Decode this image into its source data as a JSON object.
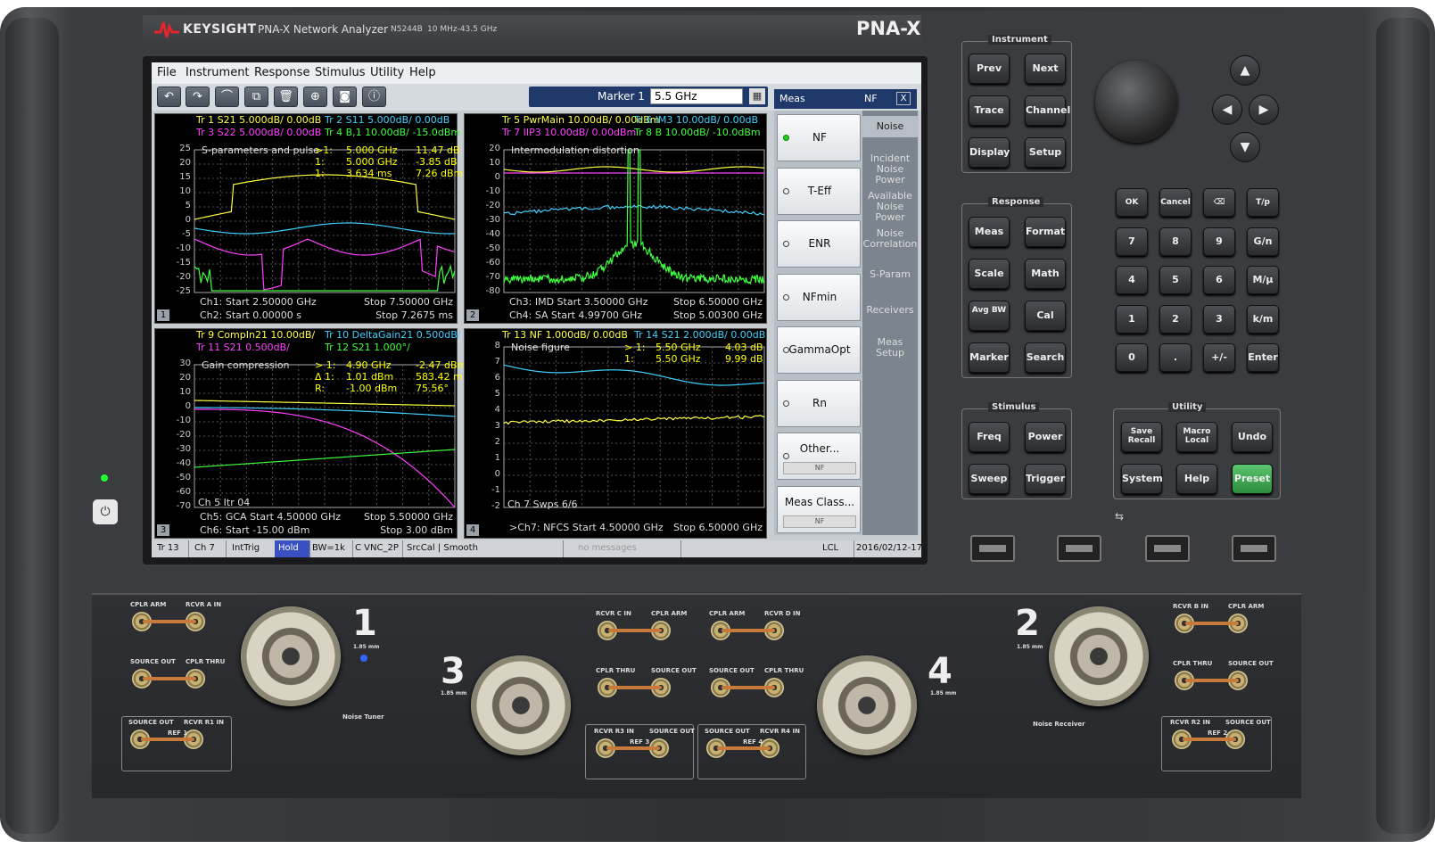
{
  "header": {
    "brand": "KEYSIGHT",
    "model_name": "PNA-X Network Analyzer",
    "model_number": "N5244B",
    "freq_range": "10 MHz-43.5 GHz",
    "series": "PNA-X"
  },
  "menu": [
    "File",
    "Instrument",
    "Response",
    "Stimulus",
    "Utility",
    "Help"
  ],
  "toolbar": {
    "icons": [
      "undo-icon",
      "redo-icon",
      "marker-add-icon",
      "copy-icon",
      "trash-icon",
      "zoom-icon",
      "camera-icon",
      "info-icon"
    ],
    "marker_label": "Marker 1",
    "marker_value": "5.5 GHz"
  },
  "meas_header": {
    "label": "Meas",
    "value": "NF",
    "close": "X"
  },
  "panes": [
    {
      "num": "1",
      "header": [
        {
          "text": "Tr 1  S21 5.000dB/  0.00dB",
          "color": "#ffff40"
        },
        {
          "text": "Tr 2  S11 5.000dB/  0.00dB",
          "color": "#40d0ff"
        },
        {
          "text": "Tr 3  S22 5.000dB/  0.00dB",
          "color": "#ff40ff"
        },
        {
          "text": "Tr 4  B,1 10.00dB/  -15.0dBm",
          "color": "#40ff40"
        }
      ],
      "title": "S-parameters and pulse",
      "markers": [
        {
          "idx": ">1:",
          "x": "5.000  GHz",
          "y": "11.47 dB"
        },
        {
          "idx": "1:",
          "x": "5.000  GHz",
          "y": "-3.85 dB"
        },
        {
          "idx": "1:",
          "x": "3.634  ms",
          "y": "7.26 dBm"
        }
      ],
      "yticks": [
        "25",
        "20",
        "15",
        "10",
        "5",
        "0",
        "-5",
        "-10",
        "-15",
        "-20",
        "-25"
      ],
      "footer": [
        {
          "l": "Ch1:  Start  2.50000 GHz",
          "r": "Stop  7.50000 GHz"
        },
        {
          "l": "Ch2:  Start  0.00000 s",
          "r": "Stop  7.2675 ms"
        }
      ]
    },
    {
      "num": "2",
      "header": [
        {
          "text": "Tr 5  PwrMain 10.00dB/  0.00dBm",
          "color": "#ffff40"
        },
        {
          "text": "Tr 6  IM3 10.00dB/  0.00dB",
          "color": "#40d0ff"
        },
        {
          "text": "Tr 7  IIP3 10.00dB/  0.00dBm",
          "color": "#ff40ff"
        },
        {
          "text": "Tr 8  B 10.00dB/  -10.0dBm",
          "color": "#40ff40"
        }
      ],
      "title": "Intermodulation distortion",
      "markers": [],
      "yticks": [
        "20",
        "10",
        "0",
        "-10",
        "-20",
        "-30",
        "-40",
        "-50",
        "-60",
        "-70",
        "-80"
      ],
      "footer": [
        {
          "l": "Ch3: IMD  Start  3.50000 GHz",
          "r": "Stop  6.50000 GHz"
        },
        {
          "l": "Ch4: SA  Start  4.99700 GHz",
          "r": "Stop  5.00300 GHz"
        }
      ]
    },
    {
      "num": "3",
      "header": [
        {
          "text": "Tr 9  CompIn21 10.00dB/",
          "color": "#ffff40"
        },
        {
          "text": "Tr 10  DeltaGain21 0.500dB/",
          "color": "#40d0ff"
        },
        {
          "text": "Tr 11  S21 0.500dB/",
          "color": "#ff40ff"
        },
        {
          "text": "Tr 12  S21 1.000°/",
          "color": "#40ff40"
        }
      ],
      "title": "Gain compression",
      "markers": [
        {
          "idx": "> 1:",
          "x": "4.90  GHz",
          "y": "-2.47 dBm"
        },
        {
          "idx": "Δ 1:",
          "x": "1.01  dBm",
          "y": "583.42 m°"
        },
        {
          "idx": "R:",
          "x": "-1.00  dBm",
          "y": "75.56°"
        }
      ],
      "yticks": [
        "30",
        "20",
        "10",
        "0",
        "-10",
        "-20",
        "-30",
        "-40",
        "-50",
        "-60",
        "-70"
      ],
      "extra": "Ch 5  Itr 04",
      "footer": [
        {
          "l": "Ch5: GCA  Start  4.50000 GHz",
          "r": "Stop  5.50000 GHz"
        },
        {
          "l": "Ch6:  Start  -15.00  dBm",
          "r": "Stop  3.00  dBm"
        }
      ]
    },
    {
      "num": "4",
      "header": [
        {
          "text": "Tr 13  NF 1.000dB/  0.00dB",
          "color": "#ffff40"
        },
        {
          "text": "Tr 14  S21 2.000dB/  0.00dB",
          "color": "#40d0ff"
        }
      ],
      "title": "Noise figure",
      "markers": [
        {
          "idx": "> 1:",
          "x": "5.50  GHz",
          "y": "4.03 dB"
        },
        {
          "idx": "1:",
          "x": "5.50  GHz",
          "y": "9.99 dB"
        }
      ],
      "yticks": [
        "8",
        "7",
        "6",
        "5",
        "4",
        "3",
        "2",
        "1",
        "0",
        "-1",
        "-2"
      ],
      "extra": "Ch 7  Swps  6/6",
      "footer": [
        {
          "l": ">Ch7: NFCS  Start  4.50000 GHz",
          "r": "Stop  6.50000 GHz"
        }
      ]
    }
  ],
  "softkeys": [
    {
      "label": "NF",
      "selected": true,
      "sub": ""
    },
    {
      "label": "T-Eff",
      "selected": false,
      "sub": ""
    },
    {
      "label": "ENR",
      "selected": false,
      "sub": ""
    },
    {
      "label": "NFmin",
      "selected": false,
      "sub": ""
    },
    {
      "label": "GammaOpt",
      "selected": false,
      "sub": ""
    },
    {
      "label": "Rn",
      "selected": false,
      "sub": ""
    },
    {
      "label": "Other...",
      "selected": false,
      "sub": "NF"
    },
    {
      "label": "Meas Class...",
      "selected": false,
      "sub": "NF"
    }
  ],
  "tabs": [
    "Noise",
    "Incident Noise Power",
    "Available Noise Power",
    "Noise Correlation",
    "S-Param",
    "Receivers",
    "Meas Setup"
  ],
  "status": [
    "Tr 13",
    "Ch 7",
    "IntTrig",
    "Hold",
    "BW=1k",
    "C  VNC_2P",
    "SrcCal | Smooth",
    "no messages",
    "LCL",
    "2016/02/12-17:58"
  ],
  "front_panel": {
    "instrument": {
      "label": "Instrument",
      "keys": [
        "Prev",
        "Next",
        "Trace",
        "Channel",
        "Display",
        "Setup"
      ]
    },
    "response": {
      "label": "Response",
      "keys": [
        "Meas",
        "Format",
        "Scale",
        "Math",
        "Avg BW",
        "Cal",
        "Marker",
        "Search"
      ]
    },
    "stimulus": {
      "label": "Stimulus",
      "keys": [
        "Freq",
        "Power",
        "Sweep",
        "Trigger"
      ]
    },
    "utility": {
      "label": "Utility",
      "keys": [
        "Save Recall",
        "Macro Local",
        "Undo",
        "System",
        "Help",
        "Preset"
      ]
    },
    "keypad": [
      "OK",
      "Cancel",
      "⌫",
      "T/p",
      "7",
      "8",
      "9",
      "G/n",
      "4",
      "5",
      "6",
      "M/μ",
      "1",
      "2",
      "3",
      "k/m",
      "0",
      ".",
      "+/-",
      "Enter"
    ],
    "arrows": [
      "▲",
      "◀",
      "▶",
      "▼"
    ]
  },
  "ports": {
    "numbers": [
      "1",
      "2",
      "3",
      "4"
    ],
    "labels": {
      "p1_cplr_arm": "CPLR ARM",
      "p1_rcvr_a": "RCVR A IN",
      "p1_source_out": "SOURCE OUT",
      "p1_cplr_thru": "CPLR THRU",
      "p1_src": "SOURCE OUT",
      "p1_rcvr_r1": "RCVR R1 IN",
      "p1_ref": "REF 1",
      "p2_rcvr_b": "RCVR B IN",
      "p2_cplr_arm": "CPLR ARM",
      "p2_cplr_thru": "CPLR THRU",
      "p2_source_out": "SOURCE OUT",
      "p2_rcvr_r2": "RCVR R2 IN",
      "p2_src": "SOURCE OUT",
      "p2_ref": "REF 2",
      "p3_rcvr_c": "RCVR C IN",
      "p3_cplr_arm": "CPLR ARM",
      "p3_cplr_thru": "CPLR THRU",
      "p3_source_out": "SOURCE OUT",
      "p3_rcvr_r3": "RCVR R3 IN",
      "p3_src": "SOURCE OUT",
      "p3_ref": "REF 3",
      "p4_cplr_arm": "CPLR ARM",
      "p4_rcvr_d": "RCVR D IN",
      "p4_source_out": "SOURCE OUT",
      "p4_cplr_thru": "CPLR THRU",
      "p4_rcvr_r4": "RCVR R4 IN",
      "p4_src": "SOURCE OUT",
      "p4_ref": "REF 4",
      "conn": "1.85 mm",
      "noise_tuner": "Noise Tuner",
      "noise_receiver": "Noise Receiver"
    }
  },
  "colors": {
    "accent": "#1f3a6a",
    "preset": "#3aa64e",
    "trace_yellow": "#ffff40",
    "trace_cyan": "#40d0ff",
    "trace_magenta": "#ff40ff",
    "trace_green": "#40ff40"
  }
}
